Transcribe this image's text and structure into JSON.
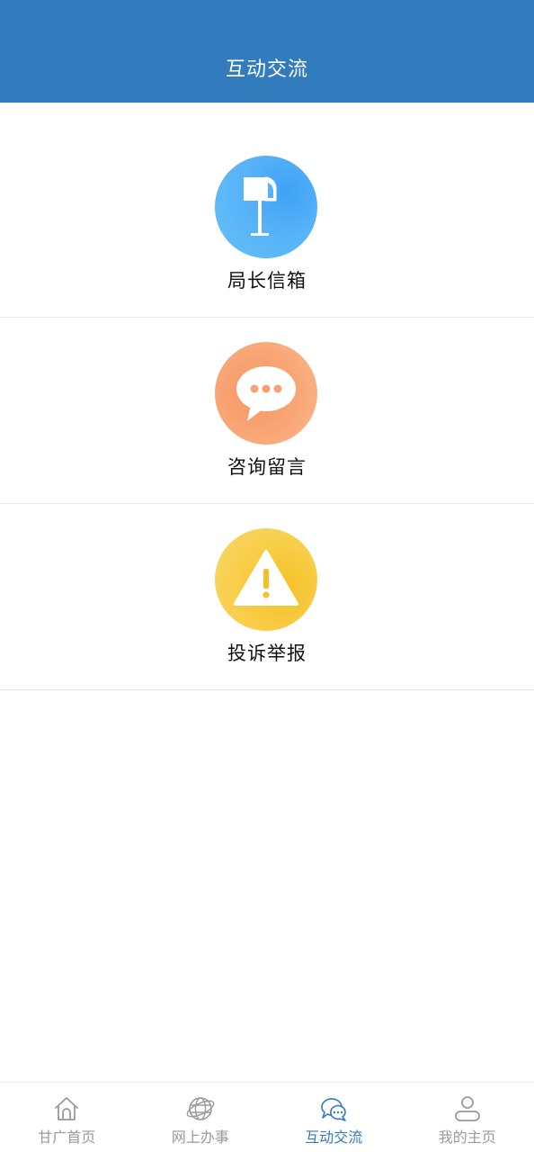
{
  "header": {
    "title": "互动交流"
  },
  "menu": {
    "items": [
      {
        "label": "局长信箱",
        "icon": "mailbox-icon",
        "color": "#4FAEF8"
      },
      {
        "label": "咨询留言",
        "icon": "chat-bubble-icon",
        "color": "#F9A272"
      },
      {
        "label": "投诉举报",
        "icon": "warning-icon",
        "color": "#F7CC45"
      }
    ]
  },
  "tabbar": {
    "active_color": "#327BBD",
    "inactive_color": "#9A9A9A",
    "tabs": [
      {
        "label": "甘广首页",
        "icon": "home-icon",
        "active": false
      },
      {
        "label": "网上办事",
        "icon": "globe-icon",
        "active": false
      },
      {
        "label": "互动交流",
        "icon": "chat-icon",
        "active": true
      },
      {
        "label": "我的主页",
        "icon": "user-icon",
        "active": false
      }
    ]
  }
}
